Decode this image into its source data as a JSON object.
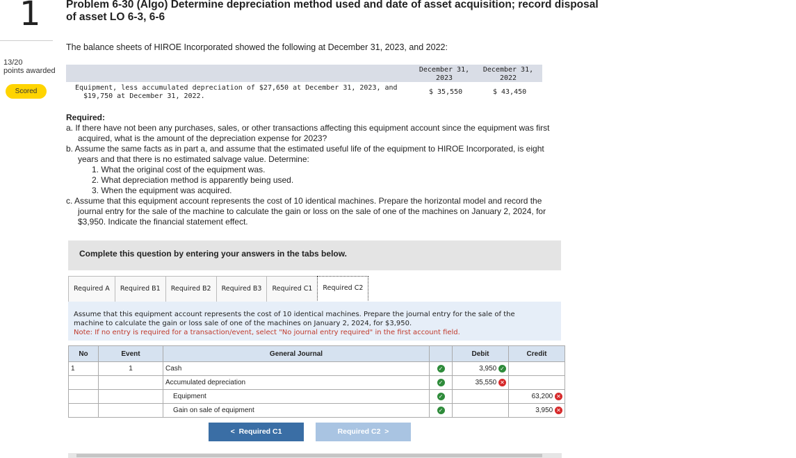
{
  "question": {
    "number": "1",
    "points": "13/20",
    "points_label": "points awarded",
    "status": "Scored"
  },
  "title": {
    "line1": "Problem 6-30 (Algo) Determine depreciation method used and date of asset acquisition; record disposal",
    "line2": "of asset LO 6-3, 6-6"
  },
  "intro": "The balance sheets of HIROE Incorporated showed the following at December 31, 2023, and 2022:",
  "balance_sheet": {
    "col1_h1": "December 31,",
    "col1_h2": "2023",
    "col2_h1": "December 31,",
    "col2_h2": "2022",
    "row_label1": "Equipment, less accumulated depreciation of $27,650 at December 31, 2023, and",
    "row_label2": "$19,750 at December 31, 2022.",
    "val1": "$ 35,550",
    "val2": "$ 43,450"
  },
  "required": {
    "heading": "Required:",
    "a1": "a. If there have not been any purchases, sales, or other transactions affecting this equipment account since the equipment was first",
    "a2": "acquired, what is the amount of the depreciation expense for 2023?",
    "b1": "b. Assume the same facts as in part a, and assume that the estimated useful life of the equipment to HIROE Incorporated, is eight",
    "b2": "years and that there is no estimated salvage value. Determine:",
    "b_i1": "1. What the original cost of the equipment was.",
    "b_i2": "2. What depreciation method is apparently being used.",
    "b_i3": "3. When the equipment was acquired.",
    "c1": "c. Assume that this equipment account represents the cost of 10 identical machines. Prepare the horizontal model and record the",
    "c2": "journal entry for the sale of the machine to calculate the gain or loss on the sale of one of the machines on January 2, 2024, for",
    "c3": "$3,950. Indicate the financial statement effect."
  },
  "complete_text": "Complete this question by entering your answers in the tabs below.",
  "tabs": [
    "Required A",
    "Required B1",
    "Required B2",
    "Required B3",
    "Required C1",
    "Required C2"
  ],
  "instructions": {
    "l1": "Assume that this equipment account represents the cost of 10 identical machines. Prepare the journal entry for the sale of the",
    "l2": "machine to calculate the gain or loss sale of one of the machines on January 2, 2024, for $3,950.",
    "note": "Note: If no entry is required for a transaction/event, select \"No journal entry required\" in the first account field."
  },
  "journal": {
    "headers": {
      "no": "No",
      "event": "Event",
      "general": "General Journal",
      "debit": "Debit",
      "credit": "Credit"
    },
    "rows": [
      {
        "no": "1",
        "event": "1",
        "account": "Cash",
        "debit": "3,950",
        "credit": ""
      },
      {
        "no": "",
        "event": "",
        "account": "Accumulated depreciation",
        "debit": "35,550",
        "credit": ""
      },
      {
        "no": "",
        "event": "",
        "account": "Equipment",
        "debit": "",
        "credit": "63,200"
      },
      {
        "no": "",
        "event": "",
        "account": "Gain on sale of equipment",
        "debit": "",
        "credit": "3,950"
      }
    ]
  },
  "nav": {
    "prev": "Required C1",
    "next": "Required C2"
  },
  "colors": {
    "correct": "#2e8b3a",
    "incorrect": "#d6292a",
    "scored_badge": "#ffd400"
  }
}
